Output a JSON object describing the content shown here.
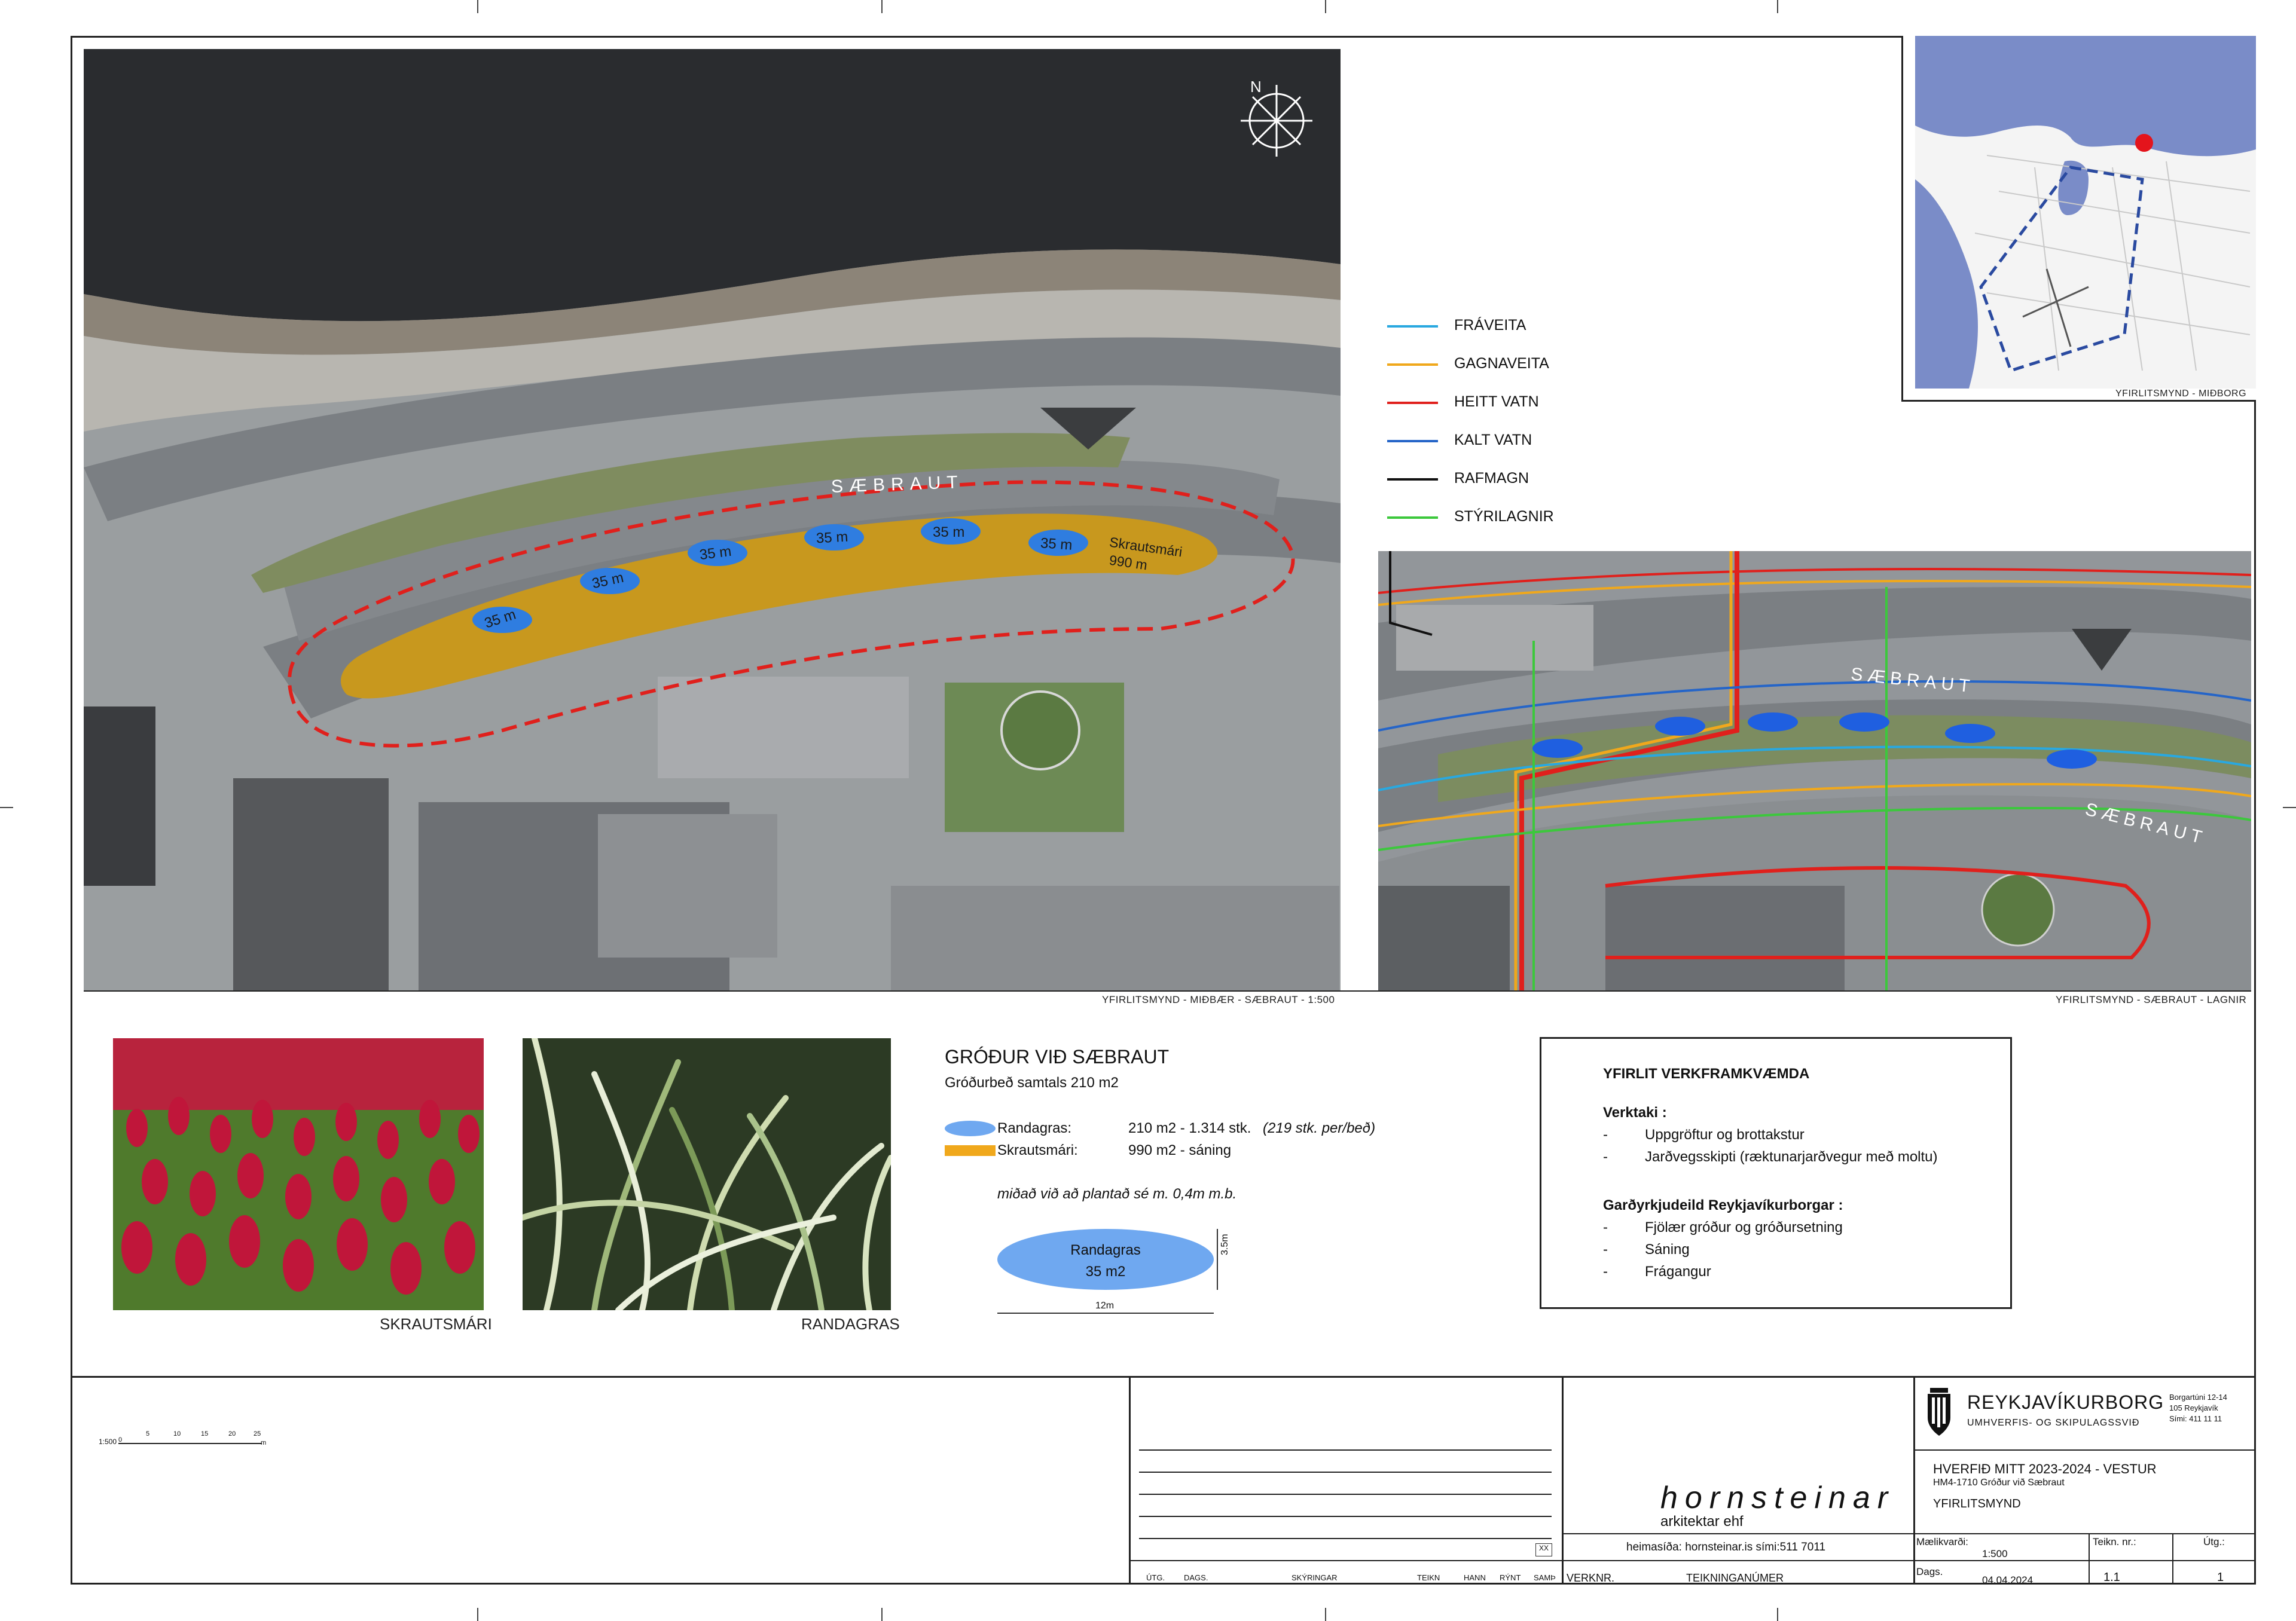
{
  "main_map": {
    "street_label": "SÆBRAUT",
    "bed_labels": [
      "35 m",
      "35 m",
      "35 m",
      "35 m",
      "35 m",
      "35 m"
    ],
    "area_label_1": "Skrautsmári",
    "area_label_2": "990 m",
    "caption": "YFIRLITSMYND - MIÐBÆR - SÆBRAUT - 1:500",
    "north": "N"
  },
  "legend": {
    "items": [
      {
        "label": "FRÁVEITA",
        "color": "#29a8e0"
      },
      {
        "label": "GAGNAVEITA",
        "color": "#f0a81c"
      },
      {
        "label": "HEITT VATN",
        "color": "#e0201c"
      },
      {
        "label": "KALT VATN",
        "color": "#2565c8"
      },
      {
        "label": "RAFMAGN",
        "color": "#111111"
      },
      {
        "label": "STÝRILAGNIR",
        "color": "#3cc83c"
      }
    ]
  },
  "location_map": {
    "caption": "YFIRLITSMYND - MIÐBORG"
  },
  "utility_map": {
    "street_label_1": "SÆBRAUT",
    "street_label_2": "SÆBRAUT",
    "caption": "YFIRLITSMYND - SÆBRAUT - LAGNIR"
  },
  "photos": {
    "clover_caption": "SKRAUTSMÁRI",
    "grass_caption": "RANDAGRAS"
  },
  "planting": {
    "title": "GRÓÐUR VIÐ SÆBRAUT",
    "subtitle": "Gróðurbeð samtals 210 m2",
    "row1_label": "Randagras:",
    "row1_value": "210 m2 - 1.314 stk.",
    "row1_note": "(219 stk. per/beð)",
    "row2_label": "Skrautsmári:",
    "row2_value": "990 m2 - sáning",
    "note": "miðað við að plantað sé m. 0,4m m.b.",
    "ellipse_line1": "Randagras",
    "ellipse_line2": "35 m2",
    "dim_height": "3.5m",
    "dim_width": "12m",
    "blue": "#6fa8f0",
    "orange": "#f0a81c"
  },
  "works": {
    "title": "YFIRLIT VERKFRAMKVÆMDA",
    "contractor_heading": "Verktaki :",
    "contractor_items": [
      "Uppgröftur og brottakstur",
      "Jarðvegsskipti (ræktunarjarðvegur með moltu)"
    ],
    "city_heading": "Garðyrkjudeild Reykjavíkurborgar :",
    "city_items": [
      "Fjölær gróður og gróðursetning",
      "Sáning",
      "Frágangur"
    ],
    "bullet": "-"
  },
  "title_block": {
    "scale_label": "1:500",
    "scale_ticks": [
      "0",
      "5",
      "10",
      "15",
      "20",
      "25"
    ],
    "scale_unit": "m",
    "rev_headers": [
      "ÚTG.",
      "DAGS.",
      "SKÝRINGAR",
      "TEIKN",
      "HANN",
      "RÝNT",
      "SAMÞ"
    ],
    "rev_box": "XX",
    "firm_name": "hornsteinar",
    "firm_sub": "arkitektar ehf",
    "firm_contact": "heimasíða: hornsteinar.is   sími:511 7011",
    "verknr": "VERKNR.",
    "teikninganumer": "TEIKNINGANÚMER",
    "org_name": "REYKJAVÍKURBORG",
    "org_dept": "UMHVERFIS- OG SKIPULAGSSVIÐ",
    "org_address": [
      "Borgartúni 12-14",
      "105 Reykjavík",
      "Sími: 411 11 11"
    ],
    "project_title": "HVERFIÐ MITT 2023-2024 - VESTUR",
    "project_code": "HM4-1710  Gróður við Sæbraut",
    "drawing_type": "YFIRLITSMYND",
    "scale_heading": "Mælikvarði:",
    "scale_value": "1:500",
    "date_heading": "Dags.",
    "date_value": "04.04.2024",
    "drawing_no_heading": "Teikn. nr.:",
    "drawing_no_value": "1.1",
    "issue_heading": "Útg.:",
    "issue_value": "1"
  }
}
